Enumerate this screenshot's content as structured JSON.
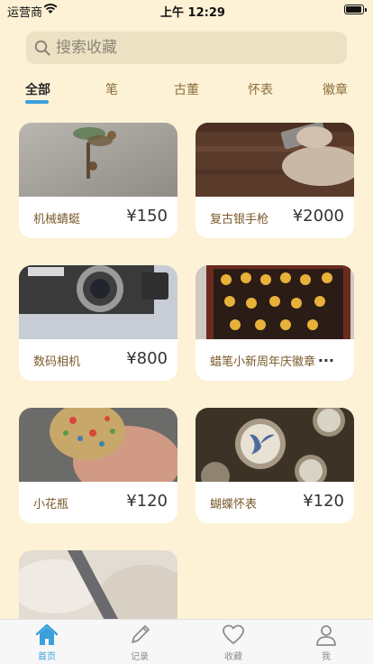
{
  "status_bar": {
    "carrier": "运营商",
    "time": "上午 12:29"
  },
  "search": {
    "placeholder": "搜索收藏",
    "icon": "search-icon"
  },
  "tabs": [
    {
      "label": "全部",
      "active": true
    },
    {
      "label": "笔",
      "active": false
    },
    {
      "label": "古董",
      "active": false
    },
    {
      "label": "怀表",
      "active": false
    },
    {
      "label": "徽章",
      "active": false
    }
  ],
  "items": [
    {
      "name": "机械蜻蜓",
      "price": "¥150"
    },
    {
      "name": "复古银手枪",
      "price": "¥2000"
    },
    {
      "name": "数码相机",
      "price": "¥800"
    },
    {
      "name": "蜡笔小新周年庆徽章",
      "price": "..."
    },
    {
      "name": "小花瓶",
      "price": "¥120"
    },
    {
      "name": "蝴蝶怀表",
      "price": "¥120"
    },
    {
      "name": "",
      "price": ""
    }
  ],
  "tab_bar": [
    {
      "label": "首页",
      "icon": "home-icon",
      "active": true
    },
    {
      "label": "记录",
      "icon": "pencil-icon",
      "active": false
    },
    {
      "label": "收藏",
      "icon": "heart-icon",
      "active": false
    },
    {
      "label": "我",
      "icon": "person-icon",
      "active": false
    }
  ],
  "colors": {
    "background": "#fdf2d6",
    "accent": "#3a9fdc",
    "card": "#ffffff"
  }
}
